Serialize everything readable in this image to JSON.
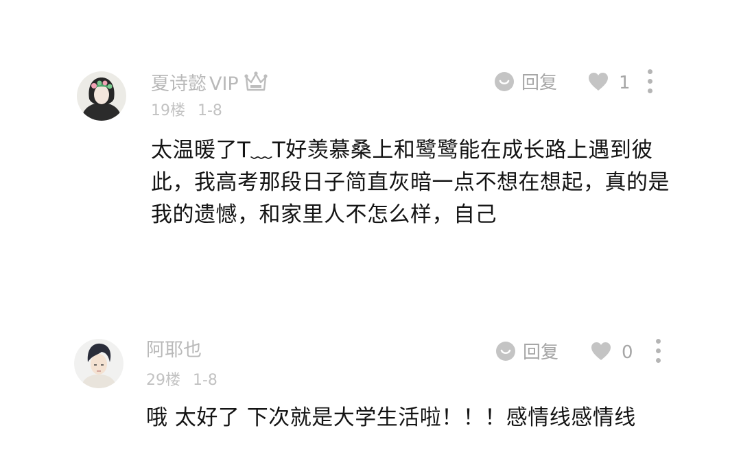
{
  "comments": [
    {
      "username": "夏诗懿",
      "vip_label": "VIP",
      "floor": "19楼",
      "date": "1-8",
      "reply_label": "回复",
      "like_count": "1",
      "text": "太温暖了T﹏T好羡慕桑上和鹭鹭能在成长路上遇到彼此，我高考那段日子简直灰暗一点不想在想起，真的是我的遗憾，和家里人不怎么样，自己"
    },
    {
      "username": "阿耶也",
      "floor": "29楼",
      "date": "1-8",
      "reply_label": "回复",
      "like_count": "0",
      "text": "哦 太好了 下次就是大学生活啦！！！感情线感情线"
    }
  ],
  "colors": {
    "meta_gray": "#b9b9b9",
    "body_text": "#141414",
    "icon_gray": "#c4c4c4"
  }
}
